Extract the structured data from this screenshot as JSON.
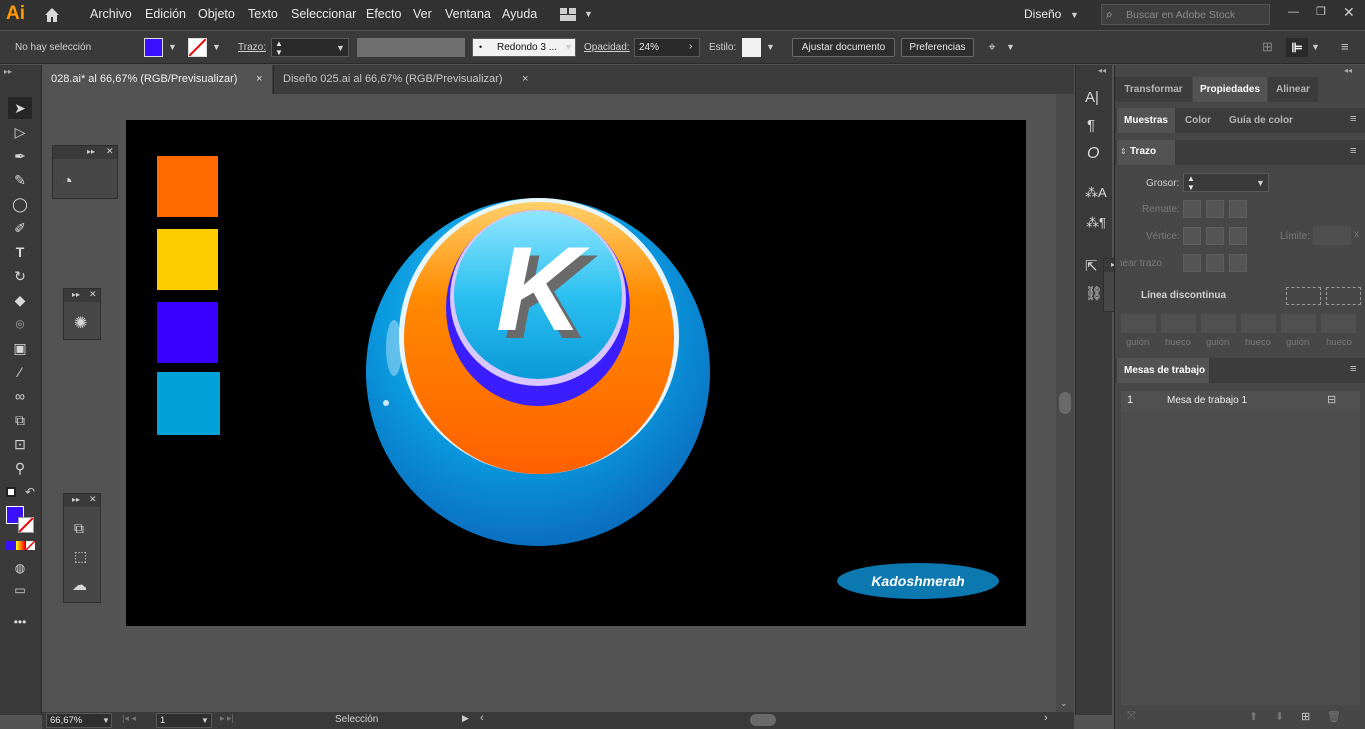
{
  "app": {
    "logo": "Ai"
  },
  "menu": {
    "items": [
      "Archivo",
      "Edición",
      "Objeto",
      "Texto",
      "Seleccionar",
      "Efecto",
      "Ver",
      "Ventana",
      "Ayuda"
    ],
    "workspace": "Diseño",
    "stock_placeholder": "Buscar en Adobe Stock"
  },
  "control": {
    "selection": "No hay selección",
    "stroke_label": "Trazo:",
    "brush": "Redondo 3 ...",
    "opacity_label": "Opacidad:",
    "opacity_value": "24%",
    "style_label": "Estilo:",
    "btn_adjust": "Ajustar documento",
    "btn_prefs": "Preferencias",
    "fill_color": "#3b0fff"
  },
  "tabs": [
    {
      "label": "028.ai* al 66,67% (RGB/Previsualizar)"
    },
    {
      "label": "Diseño 025.ai al 66,67% (RGB/Previsualizar)"
    }
  ],
  "status": {
    "zoom": "66,67%",
    "page": "1",
    "tool": "Selección"
  },
  "swatches": [
    "#ff6a00",
    "#ffcc00",
    "#3a00ff",
    "#00a0d8"
  ],
  "artwork": {
    "letter": "K",
    "signature": "Kadoshmerah"
  },
  "rpanel": {
    "tabs": [
      "Transformar",
      "Propiedades",
      "Alinear"
    ],
    "subtabs": [
      "Muestras",
      "Color",
      "Guía de color"
    ],
    "stroke_title": "Trazo",
    "weight_label": "Grosor:",
    "cap_label": "Remate:",
    "corner_label": "Vértice:",
    "limit_label": "Límite:",
    "align_label": "Alinear trazo:",
    "dashed_label": "Línea discontinua",
    "dash_labels": [
      "guión",
      "hueco",
      "guión",
      "hueco",
      "guión",
      "hueco"
    ],
    "artboards_title": "Mesas de trabajo",
    "artboards": [
      {
        "num": "1",
        "name": "Mesa de trabajo 1"
      }
    ]
  },
  "colors": {
    "bg": "#535353",
    "accent": "#ff9a00",
    "selection": "#3b0fff"
  }
}
